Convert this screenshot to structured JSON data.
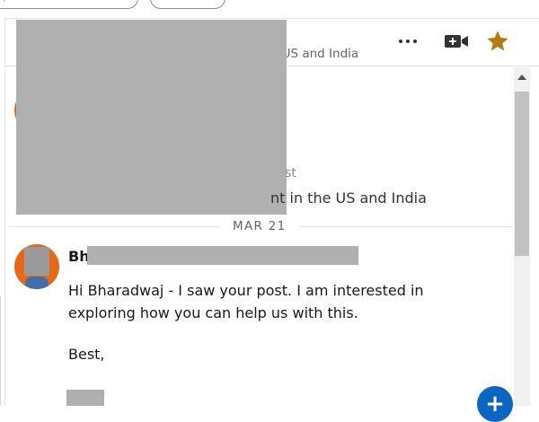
{
  "header": {
    "subtitle_fragment": "e US and India",
    "more_icon": "more-horizontal-icon",
    "video_icon": "video-call-icon",
    "star_icon": "star-icon",
    "star_color": "#b57c0d"
  },
  "thread": {
    "first_message": {
      "fragment_1": "st",
      "fragment_2": "nt in the US and India"
    },
    "date_separator": "MAR 21",
    "second_message": {
      "sender_visible": "Bh",
      "body": "Hi Bharadwaj - I saw your post. I am interested in exploring how you can help us with this.",
      "signoff": "Best,"
    }
  },
  "fab": {
    "label": "+",
    "color": "#0a66c2"
  },
  "colors": {
    "avatar_bg": "#e8681a",
    "redaction": "#b0b0b0"
  }
}
